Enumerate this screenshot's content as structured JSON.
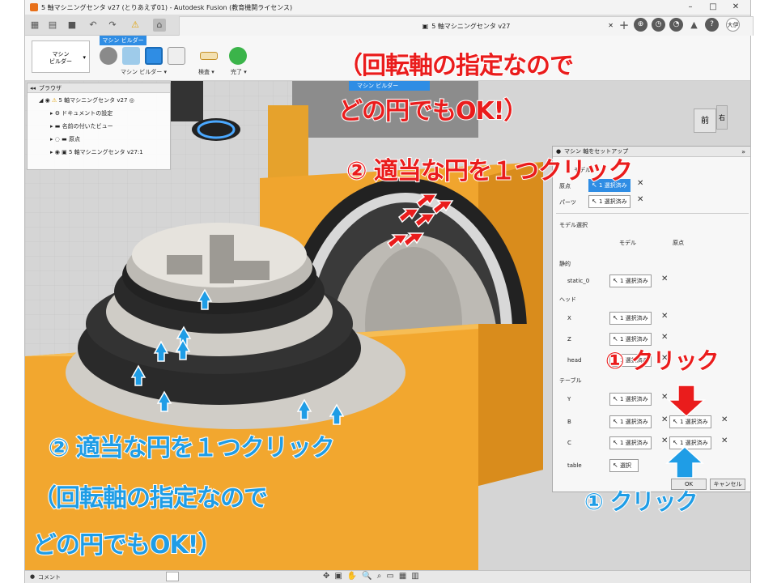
{
  "window": {
    "title": "5 軸マシニングセンタ v27 (とりあえず01) - Autodesk Fusion (教育機関ライセンス)",
    "minimize": "–",
    "maximize": "□",
    "close": "✕"
  },
  "tabbar": {
    "doc_tab_label": "5 軸マシニングセンタ v27",
    "user_initials": "大伊"
  },
  "ribbon": {
    "workspace_label": "マシン\nビルダー",
    "active_tab": "マシン ビルダー",
    "group_machine_builder": "マシン ビルダー ▾",
    "inspect": "検査 ▾",
    "finish": "完了 ▾"
  },
  "browser": {
    "title": "ブラウザ",
    "root": "5 軸マシニングセンタ v27",
    "items": [
      {
        "label": "ドキュメントの設定",
        "icon": "gear-icon"
      },
      {
        "label": "名前の付いたビュー",
        "icon": "folder-icon"
      },
      {
        "label": "原点",
        "icon": "folder-icon"
      },
      {
        "label": "5 軸マシニングセンタ v27:1",
        "icon": "component-icon"
      }
    ]
  },
  "floating_toolbar": {
    "label": "マシン ビルダー"
  },
  "viewcube": {
    "front": "前",
    "right": "右"
  },
  "dialog": {
    "title": "マシン 軸をセットアップ",
    "section_model_top": "モデル",
    "origin_label": "原点",
    "parts_label": "パーツ",
    "selected_1": "1 選択済み",
    "section_model_select": "モデル選択",
    "col_model": "モデル",
    "col_origin": "原点",
    "static_group": "静的",
    "static_0": "static_0",
    "head_group": "ヘッド",
    "x_label": "X",
    "z_label": "Z",
    "head_label": "head",
    "table_group": "テーブル",
    "y_label": "Y",
    "b_label": "B",
    "c_label": "C",
    "table_label": "table",
    "select_label": "選択",
    "ok": "OK",
    "cancel": "キャンセル"
  },
  "status": {
    "comment": "コメント"
  },
  "annotations": {
    "red_note_line1": "（回転軸の指定なので",
    "red_note_line2": "どの円でもOK!）",
    "red_step2": "② 適当な円を１つクリック",
    "red_step1": "① クリック",
    "blue_step2": "② 適当な円を１つクリック",
    "blue_note_line1": "（回転軸の指定なので",
    "blue_note_line2": "どの円でもOK!）",
    "blue_step1": "① クリック"
  },
  "colors": {
    "accent": "#2f8de4",
    "annotation_red": "#ea1c1c",
    "annotation_blue": "#1f9de6",
    "part_orange": "#f2a72f",
    "part_dark": "#2a2a2a",
    "part_gray": "#bdbab4"
  }
}
